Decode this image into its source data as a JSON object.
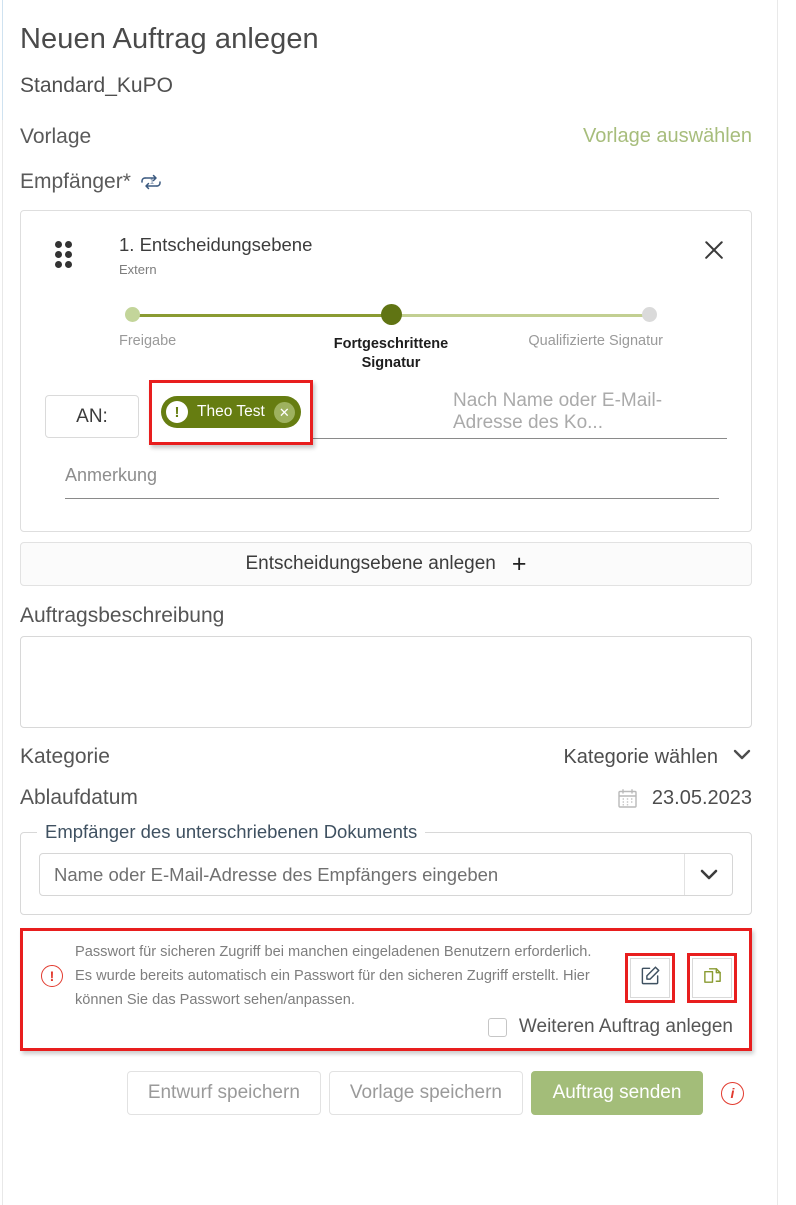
{
  "header": {
    "title": "Neuen Auftrag anlegen",
    "subtitle": "Standard_KuPO"
  },
  "template_row": {
    "label": "Vorlage",
    "action_label": "Vorlage auswählen",
    "accent_color": "#a7bd7c"
  },
  "recipients_row": {
    "label": "Empfänger*",
    "repeat_icon": "repeat-one-icon"
  },
  "level_card": {
    "drag_handle_icon": "drag-handle-icon",
    "title": "1. Entscheidungsebene",
    "subtitle": "Extern",
    "close_icon": "close-icon",
    "stepper": {
      "steps": [
        {
          "label": "Freigabe",
          "state": "done"
        },
        {
          "label": "Fortgeschrittene Signatur",
          "state": "active"
        },
        {
          "label": "Qualifizierte Signatur",
          "state": "todo"
        }
      ],
      "active_color": "#607413",
      "done_color": "#c3d59a",
      "todo_color": "#dadada"
    },
    "to_label": "AN:",
    "chip": {
      "alert_icon": "alert-exclamation-icon",
      "name": "Theo Test",
      "remove_icon": "remove-icon",
      "background_color": "#667d11",
      "highlighted": true
    },
    "recipient_placeholder": "Nach Name oder E-Mail-Adresse des Ko...",
    "note_placeholder": "Anmerkung"
  },
  "add_level_button": {
    "label": "Entscheidungsebene anlegen",
    "plus_icon": "plus-icon"
  },
  "description": {
    "label": "Auftragsbeschreibung",
    "value": "",
    "placeholder": ""
  },
  "category": {
    "label": "Kategorie",
    "value": "Kategorie wählen",
    "chevron_icon": "chevron-down-icon"
  },
  "expiry": {
    "label": "Ablaufdatum",
    "calendar_icon": "calendar-icon",
    "value": "23.05.2023"
  },
  "signed_doc_recipient": {
    "legend": "Empfänger des unterschriebenen Dokuments",
    "placeholder": "Name oder E-Mail-Adresse des Empfängers eingeben",
    "chevron_icon": "chevron-down-icon"
  },
  "password_notice": {
    "highlighted": true,
    "highlight_color": "#e81e1e",
    "alert_icon": "alert-circle-icon",
    "lines": [
      "Passwort für sicheren Zugriff bei manchen eingeladenen Benutzern erforderlich.",
      "Es wurde bereits automatisch ein Passwort für den sicheren Zugriff erstellt. Hier",
      "können Sie das Passwort sehen/anpassen."
    ],
    "edit_button_icon": "edit-pencil-icon",
    "copy_button_icon": "copy-icon",
    "checkbox": {
      "label": "Weiteren Auftrag anlegen",
      "checked": false
    }
  },
  "footer": {
    "save_draft_label": "Entwurf speichern",
    "save_template_label": "Vorlage speichern",
    "send_label": "Auftrag senden",
    "send_color": "#a3bd79",
    "info_icon": "info-circle-icon"
  }
}
